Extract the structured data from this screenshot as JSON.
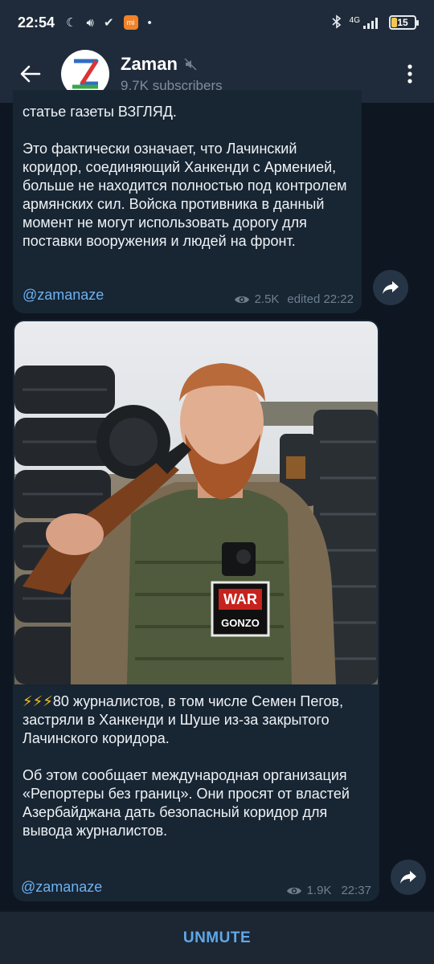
{
  "status_bar": {
    "time": "22:54",
    "network": "4G",
    "battery": "15"
  },
  "header": {
    "channel_name": "Zaman",
    "subscribers": "9.7K subscribers",
    "avatar_letter": "Z"
  },
  "messages": [
    {
      "text": "статье газеты ВЗГЛЯД.\n\nЭто фактически означает, что Лачинский коридор, соединяющий Ханкенди с Арменией, больше не находится полностью под контролем армянских сил. Войска противника в данный момент не могут использовать дорогу для поставки вооружения и людей на фронт.",
      "signature": "@zamanaze",
      "views": "2.5K",
      "time": "edited 22:22"
    },
    {
      "photo_badge_line1": "WAR",
      "photo_badge_line2": "GONZO",
      "emoji": "⚡⚡⚡",
      "text": "80 журналистов, в том числе Семен Пегов, застряли в Ханкенди и Шуше из-за закрытого Лачинского коридора.\n\nОб этом сообщает международная организация «Репортеры без границ». Они просят от властей Азербайджана дать безопасный коридор для вывода журналистов.",
      "signature": "@zamanaze",
      "views": "1.9K",
      "time": "22:37"
    }
  ],
  "bottom_bar": {
    "action": "UNMUTE"
  },
  "colors": {
    "background": "#0e1621",
    "bubble": "#182533",
    "header": "#1f2b3a",
    "link": "#6ab2f2",
    "accent": "#5fa8e8"
  }
}
